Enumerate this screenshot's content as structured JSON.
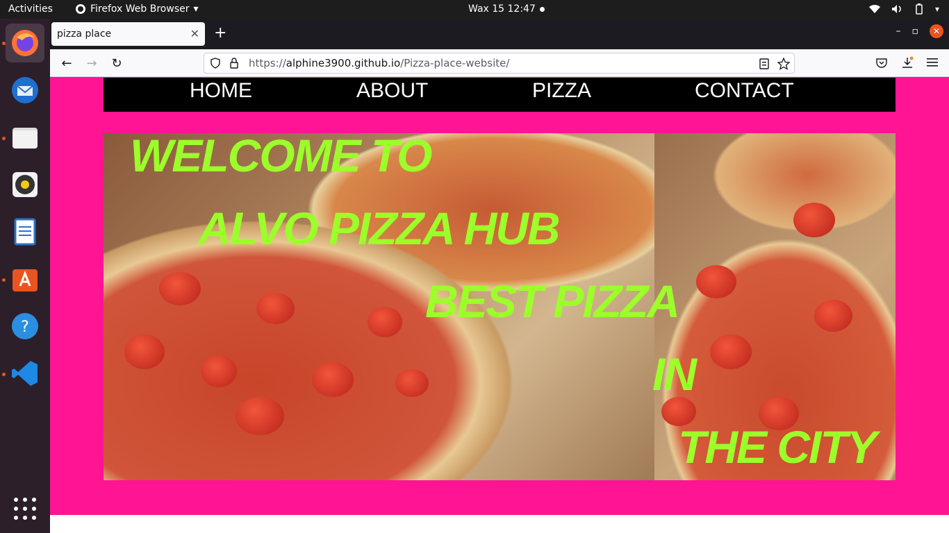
{
  "system": {
    "activities": "Activities",
    "app_name": "Firefox Web Browser",
    "clock": "Wax 15  12:47"
  },
  "browser": {
    "tab_title": "pizza place",
    "url_scheme": "https://",
    "url_host": "alphine3900.github.io",
    "url_path": "/Pizza-place-website/"
  },
  "site": {
    "nav": [
      "HOME",
      "ABOUT",
      "PIZZA",
      "CONTACT"
    ],
    "hero_lines": [
      "WELCOME TO",
      "ALVO PIZZA HUB",
      "BEST PIZZA",
      "IN",
      "THE CITY"
    ],
    "colors": {
      "page_bg": "#ff1493",
      "nav_bg": "#000000",
      "hero_text": "#9cff2a"
    }
  },
  "dock": {
    "apps": [
      "firefox-icon",
      "thunderbird-icon",
      "files-icon",
      "rhythmbox-icon",
      "libreoffice-writer-icon",
      "software-center-icon",
      "help-icon",
      "vscode-icon"
    ]
  }
}
